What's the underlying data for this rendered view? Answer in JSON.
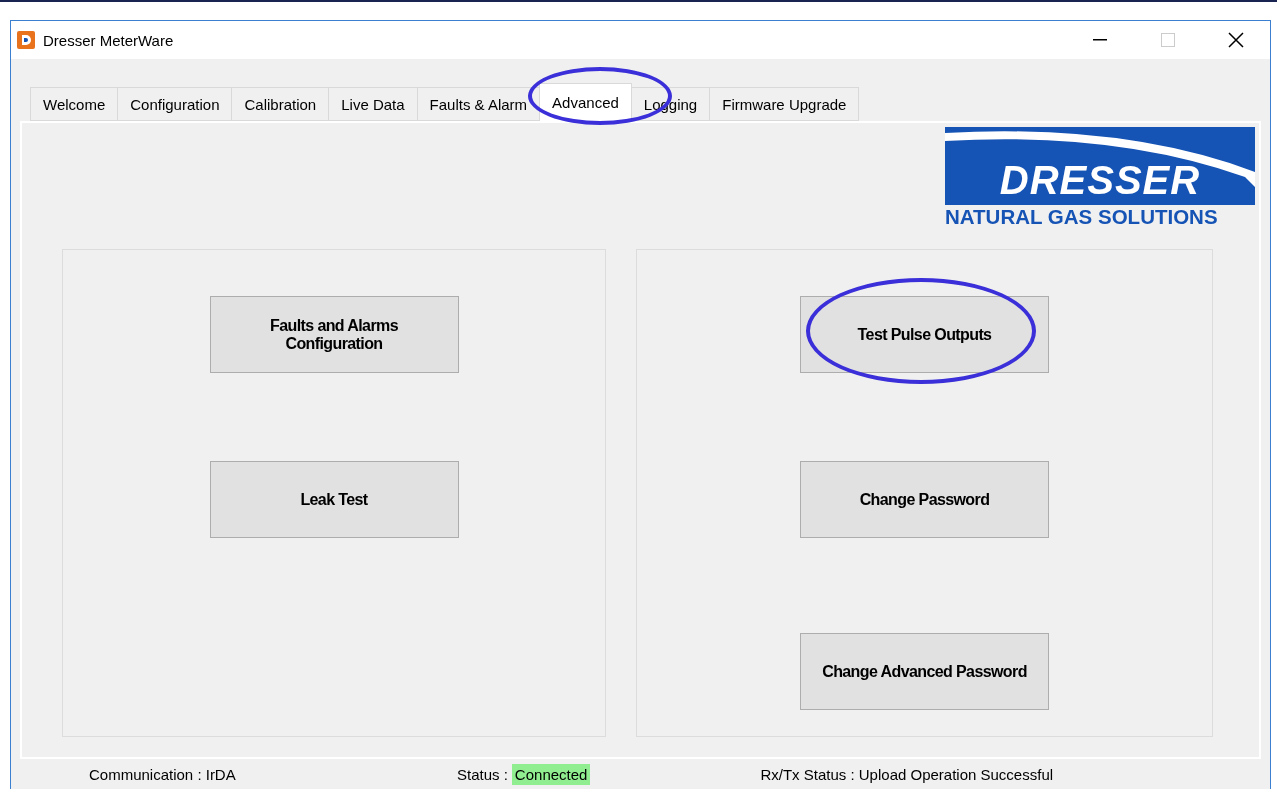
{
  "window": {
    "title": "Dresser MeterWare"
  },
  "tabs": [
    {
      "label": "Welcome",
      "selected": false,
      "circled": false
    },
    {
      "label": "Configuration",
      "selected": false,
      "circled": false
    },
    {
      "label": "Calibration",
      "selected": false,
      "circled": false
    },
    {
      "label": "Live Data",
      "selected": false,
      "circled": false
    },
    {
      "label": "Faults & Alarm",
      "selected": false,
      "circled": false
    },
    {
      "label": "Advanced",
      "selected": true,
      "circled": true
    },
    {
      "label": "Logging",
      "selected": false,
      "circled": false
    },
    {
      "label": "Firmware Upgrade",
      "selected": false,
      "circled": false
    }
  ],
  "logo": {
    "wordmark": "DRESSER",
    "tagline": "NATURAL GAS SOLUTIONS"
  },
  "left_group": {
    "buttons": [
      {
        "label": "Faults and Alarms\nConfiguration",
        "circled": false
      },
      {
        "label": "Leak Test",
        "circled": false
      }
    ]
  },
  "right_group": {
    "buttons": [
      {
        "label": "Test Pulse Outputs",
        "circled": true
      },
      {
        "label": "Change Password",
        "circled": false
      },
      {
        "label": "Change Advanced Password",
        "circled": false
      }
    ]
  },
  "status_bar": {
    "communication": "Communication : IrDA",
    "status_label": "Status :",
    "status_value": "Connected",
    "rxtx": "Rx/Tx Status : Upload Operation Successful"
  }
}
